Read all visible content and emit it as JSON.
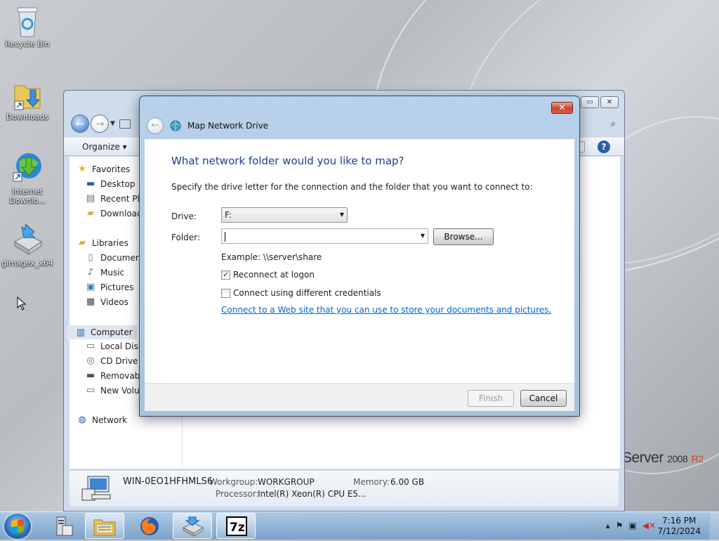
{
  "desktop": {
    "icons": [
      {
        "label": "Recycle Bin"
      },
      {
        "label": "Downloads"
      },
      {
        "label": "Internet Downlo..."
      },
      {
        "label": "gimagex_x64"
      }
    ],
    "branding": {
      "word": "Server",
      "version": "2008",
      "release": "R2"
    }
  },
  "explorer": {
    "organize_label": "Organize ▾",
    "nav": {
      "favorites": "Favorites",
      "desktop": "Desktop",
      "recent": "Recent Pl",
      "downloads": "Downloads",
      "libraries": "Libraries",
      "documents": "Documer",
      "music": "Music",
      "pictures": "Pictures",
      "videos": "Videos",
      "computer": "Computer",
      "local_disk": "Local Disk",
      "cd_drive": "CD Drive",
      "removable": "Removab",
      "new_volume": "New Volu",
      "network": "Network"
    },
    "details": {
      "computer_name": "WIN-0EO1HFHMLS6",
      "workgroup_label": "Workgroup:",
      "workgroup_value": "WORKGROUP",
      "memory_label": "Memory:",
      "memory_value": "6.00 GB",
      "processor_label": "Processor:",
      "processor_value": "Intel(R) Xeon(R) CPU E5..."
    }
  },
  "dialog": {
    "title": "Map Network Drive",
    "close_label": "✕",
    "heading": "What network folder would you like to map?",
    "instructions": "Specify the drive letter for the connection and the folder that you want to connect to:",
    "drive_label": "Drive:",
    "drive_value": "F:",
    "folder_label": "Folder:",
    "folder_value": "",
    "browse_label": "Browse...",
    "example": "Example: \\\\server\\share",
    "reconnect_label": "Reconnect at logon",
    "reconnect_checked": true,
    "credentials_label": "Connect using different credentials",
    "credentials_checked": false,
    "link_text": "Connect to a Web site that you can use to store your documents and pictures",
    "link_suffix": ".",
    "finish_label": "Finish",
    "cancel_label": "Cancel"
  },
  "taskbar": {
    "time": "7:16 PM",
    "date": "7/12/2024",
    "apps": [
      "server-manager",
      "windows-explorer",
      "firefox",
      "gimagex",
      "7-zip"
    ]
  },
  "colors": {
    "heading_blue": "#1e3e8c",
    "link_blue": "#0066cc",
    "close_red": "#c8452d"
  }
}
